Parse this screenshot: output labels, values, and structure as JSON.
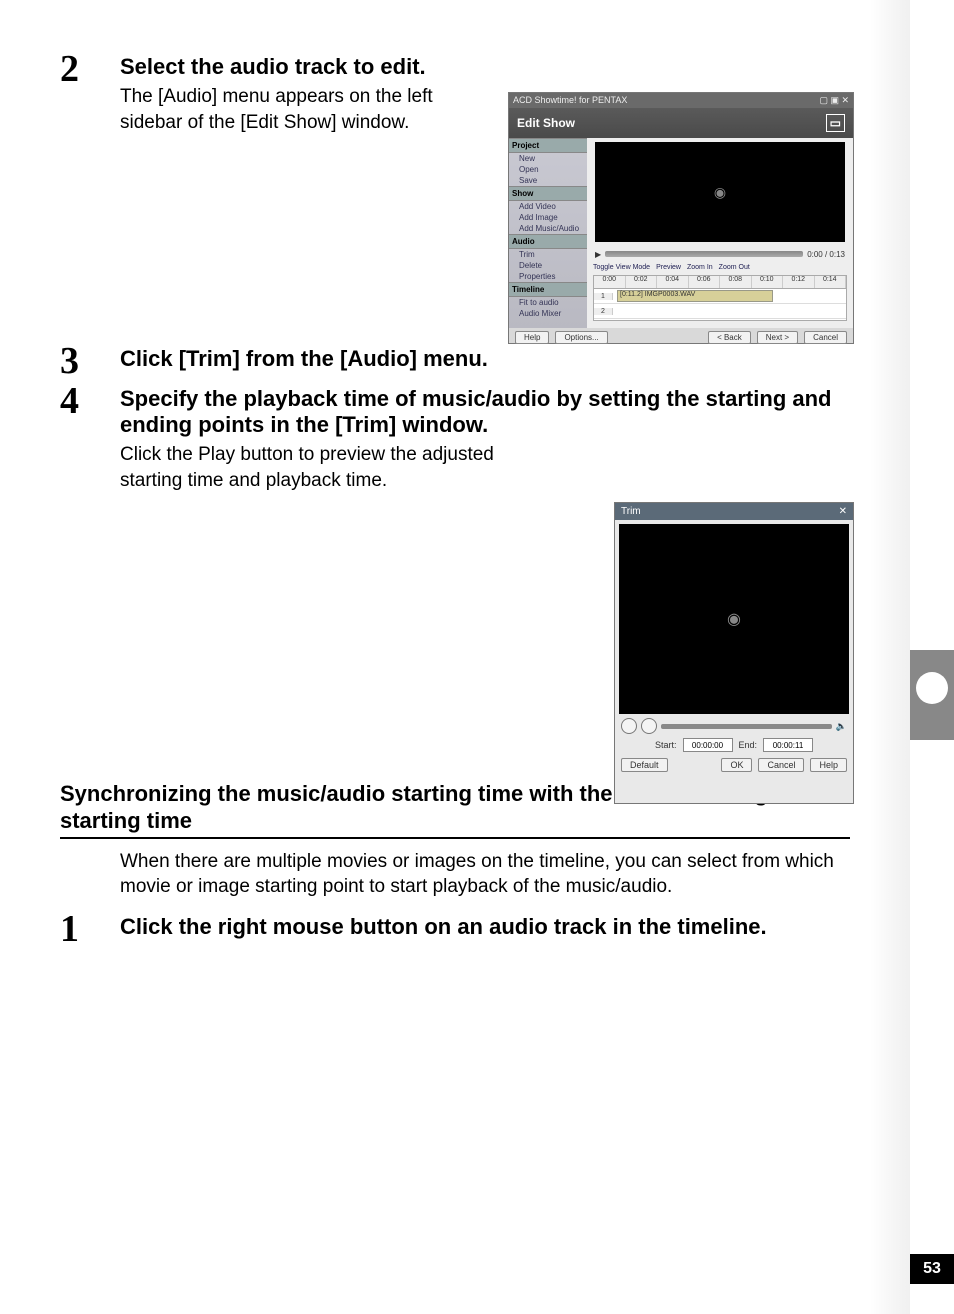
{
  "page_number": "53",
  "steps_top": [
    {
      "num": "2",
      "title": "Select the audio track to edit.",
      "desc": "The [Audio] menu appears on the left sidebar of the [Edit Show] window."
    },
    {
      "num": "3",
      "title": "Click [Trim] from the [Audio] menu."
    },
    {
      "num": "4",
      "title": "Specify the playback time of music/audio by setting the starting and ending points in the [Trim] window.",
      "desc": "Click the Play button to preview the adjusted starting time and playback time."
    }
  ],
  "sync_heading": "Synchronizing the music/audio starting time with the movie or image starting time",
  "sync_desc": "When there are multiple movies or images on the timeline, you can select from which movie or image starting point to start playback of the music/audio.",
  "steps_bottom": [
    {
      "num": "1",
      "title": "Click the right mouse button on an audio track in the timeline."
    }
  ],
  "shot1": {
    "app_title": "ACD Showtime! for PENTAX",
    "header": "Edit Show",
    "groups": {
      "project": {
        "h": "Project",
        "items": [
          "New",
          "Open",
          "Save"
        ]
      },
      "show": {
        "h": "Show",
        "items": [
          "Add Video",
          "Add Image",
          "Add Music/Audio"
        ]
      },
      "audio": {
        "h": "Audio",
        "items": [
          "Trim",
          "Delete",
          "Properties"
        ]
      },
      "timeline": {
        "h": "Timeline",
        "items": [
          "Fit to audio",
          "Audio Mixer"
        ]
      }
    },
    "time_label": "0:00 / 0:13",
    "tools": [
      "Toggle View Mode",
      "Preview",
      "Zoom In",
      "Zoom Out"
    ],
    "ruler": [
      "0:00",
      "0:02",
      "0:04",
      "0:06",
      "0:08",
      "0:10",
      "0:12",
      "0:14"
    ],
    "clip_label": "[0:11.2] IMGP0003.WAV",
    "row_labels": {
      "a": "1",
      "b": "2"
    },
    "footer": {
      "help": "Help",
      "options": "Options...",
      "back": "< Back",
      "next": "Next >",
      "cancel": "Cancel"
    },
    "win_btn": "▢ ▣ ✕"
  },
  "shot2": {
    "title": "Trim",
    "close": "✕",
    "start_lbl": "Start:",
    "start_val": "00:00:00",
    "end_lbl": "End:",
    "end_val": "00:00:11",
    "buttons": {
      "default": "Default",
      "ok": "OK",
      "cancel": "Cancel",
      "help": "Help"
    },
    "speaker": "🔈"
  }
}
